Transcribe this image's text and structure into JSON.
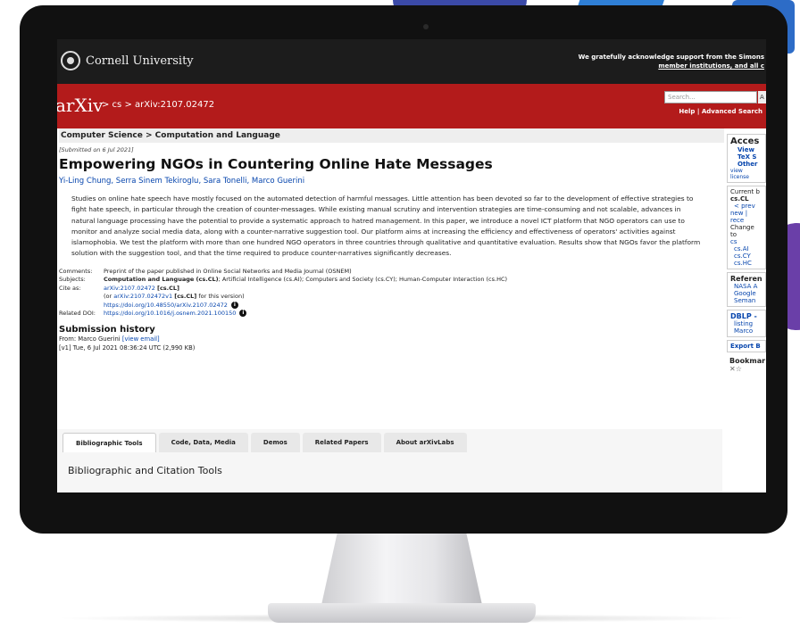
{
  "header": {
    "institution": "Cornell University",
    "support_line1": "We gratefully acknowledge support from the Simons",
    "support_line2": "member institutions, and all c"
  },
  "arxiv_bar": {
    "logo": "arXiv",
    "breadcrumb": "> cs > arXiv:2107.02472",
    "search_placeholder": "Search...",
    "search_button": "A",
    "help_links": "Help | Advanced Search"
  },
  "paper": {
    "subject_bar": "Computer Science > Computation and Language",
    "submitted": "[Submitted on 6 Jul 2021]",
    "title": "Empowering NGOs in Countering Online Hate Messages",
    "authors": "Yi-Ling Chung, Serra Sinem Tekiroglu, Sara Tonelli, Marco Guerini",
    "abstract": "Studies on online hate speech have mostly focused on the automated detection of harmful messages. Little attention has been devoted so far to the development of effective strategies to fight hate speech, in particular through the creation of counter-messages. While existing manual scrutiny and intervention strategies are time-consuming and not scalable, advances in natural language processing have the potential to provide a systematic approach to hatred management. In this paper, we introduce a novel ICT platform that NGO operators can use to monitor and analyze social media data, along with a counter-narrative suggestion tool. Our platform aims at increasing the efficiency and effectiveness of operators' activities against islamophobia. We test the platform with more than one hundred NGO operators in three countries through qualitative and quantitative evaluation. Results show that NGOs favor the platform solution with the suggestion tool, and that the time required to produce counter-narratives significantly decreases."
  },
  "meta": {
    "comments_label": "Comments:",
    "comments": "Preprint of the paper published in Online Social Networks and Media Journal (OSNEM)",
    "subjects_label": "Subjects:",
    "subjects_main": "Computation and Language (cs.CL)",
    "subjects_rest": "; Artificial Intelligence (cs.AI); Computers and Society (cs.CY); Human-Computer Interaction (cs.HC)",
    "cite_label": "Cite as:",
    "cite_id": "arXiv:2107.02472",
    "cite_cat": "[cs.CL]",
    "cite_version_prefix": "(or ",
    "cite_version_id": "arXiv:2107.02472v1",
    "cite_version_cat": "[cs.CL]",
    "cite_version_suffix": " for this version)",
    "cite_doi": "https://doi.org/10.48550/arXiv.2107.02472",
    "related_doi_label": "Related DOI:",
    "related_doi": "https://doi.org/10.1016/j.osnem.2021.100150"
  },
  "submission": {
    "heading": "Submission history",
    "from_prefix": "From: Marco Guerini ",
    "from_link": "[view email]",
    "version": "[v1] Tue, 6 Jul 2021 08:36:24 UTC (2,990 KB)"
  },
  "tabs": {
    "items": [
      "Bibliographic Tools",
      "Code, Data, Media",
      "Demos",
      "Related Papers",
      "About arXivLabs"
    ],
    "panel_title": "Bibliographic and Citation Tools"
  },
  "sidebar": {
    "access_heading": "Acces",
    "access_links": [
      "View",
      "TeX S",
      "Other"
    ],
    "view_license": "view license",
    "current_browse_label": "Current b",
    "current_browse_cat": "cs.CL",
    "prev": "< prev",
    "new_recent": "new | rece",
    "change_to": "Change to",
    "change_cats": [
      "cs",
      "cs.AI",
      "cs.CY",
      "cs.HC"
    ],
    "refs_heading": "Referen",
    "refs_links": [
      "NASA A",
      "Google",
      "Seman"
    ],
    "dblp_heading": "DBLP -",
    "dblp_links": [
      "listing",
      "Marco"
    ],
    "export": "Export B",
    "bookmark": "Bookmar"
  }
}
